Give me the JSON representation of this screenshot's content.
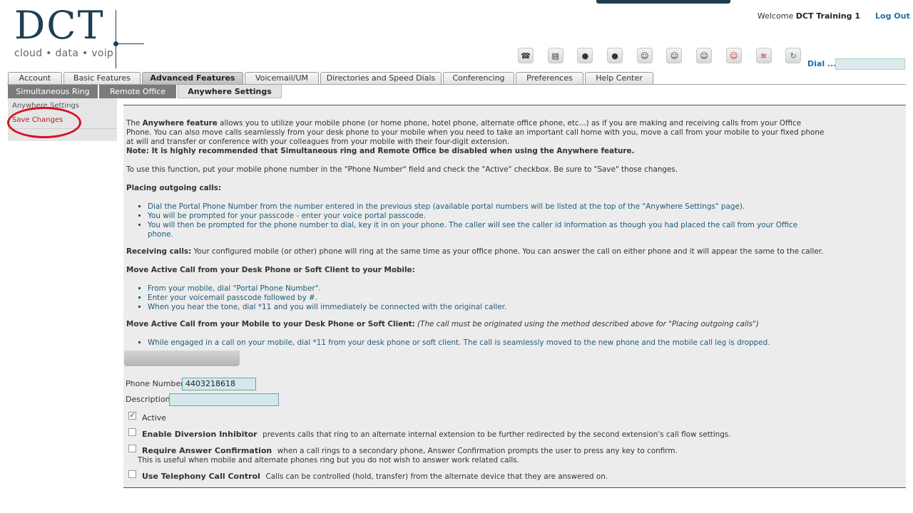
{
  "logo": {
    "letters": "DCT",
    "tagline": "cloud • data • voip"
  },
  "header": {
    "welcome_prefix": "Welcome",
    "user_name": "DCT Training 1",
    "logout": "Log Out",
    "dial_label": "Dial ...",
    "dial_value": ""
  },
  "icons": [
    "contacts-icon",
    "notes-icon",
    "voicemail-8-icon",
    "voicemail-700-icon",
    "user-icon",
    "user-group-icon",
    "user-admin-icon",
    "user-red-icon",
    "wifi-icon",
    "refresh-icon"
  ],
  "tabs": [
    {
      "label": "Account"
    },
    {
      "label": "Basic Features"
    },
    {
      "label": "Advanced Features"
    },
    {
      "label": "Voicemail/UM"
    },
    {
      "label": "Directories and Speed Dials"
    },
    {
      "label": "Conferencing"
    },
    {
      "label": "Preferences"
    },
    {
      "label": "Help Center"
    }
  ],
  "subtabs": [
    {
      "label": "Simultaneous Ring"
    },
    {
      "label": "Remote Office"
    },
    {
      "label": "Anywhere Settings"
    }
  ],
  "sidenav": {
    "item1": "Anywhere Settings",
    "item2": "Save Changes"
  },
  "content": {
    "intro_1": "The ",
    "intro_bold": "Anywhere feature",
    "intro_2": " allows you to utilize your mobile phone (or home phone, hotel phone, alternate office phone, etc...) as if you are making and receiving calls from your Office Phone. You can also move calls seamlessly from your desk phone to your mobile when you need to take an important call home with you, move a call from your mobile to your fixed phone at will and transfer or conference with your colleagues from your mobile with their four-digit extension.",
    "note": "Note: It is highly recommended that Simultaneous ring and Remote Office be disabled when using the Anywhere feature.",
    "use_text": "To use this function, put your mobile phone number in the \"Phone Number\" field and check the \"Active\" checkbox. Be sure to \"Save\" those changes.",
    "outgoing_head": "Placing outgoing calls:",
    "outgoing_items": [
      "Dial the Portal Phone Number from the number entered in the previous step (available portal numbers will be listed at the top of the \"Anywhere Settings\" page).",
      "You will be prompted for your passcode - enter your voice portal passcode.",
      "You will then be prompted for the phone number to dial, key it in on your phone. The caller will see the caller id information as though you had placed the call from your Office phone."
    ],
    "receiving_head": "Receiving calls:",
    "receiving_text": " Your configured mobile (or other) phone will ring at the same time as your office phone. You can answer the call on either phone and it will appear the same to the caller.",
    "desk_to_mobile_head": "Move Active Call from your Desk Phone or Soft Client to your Mobile:",
    "desk_to_mobile_items": [
      "From your mobile, dial \"Portal Phone Number\".",
      "Enter your voicemail passcode followed by #.",
      "When you hear the tone, dial *11 and you will immediately be connected with the original caller."
    ],
    "mobile_to_desk_head": "Move Active Call from your Mobile to your Desk Phone or Soft Client:",
    "mobile_to_desk_note": " (The call must be originated using the method described above for \"Placing outgoing calls\")",
    "mobile_to_desk_items": [
      "While engaged in a call on your mobile, dial *11 from your desk phone or soft client. The call is seamlessly moved to the new phone and the mobile call leg is dropped."
    ]
  },
  "form": {
    "phone_label": "Phone Number:",
    "phone_value": "4403218618",
    "desc_label": "Description:",
    "desc_value": "",
    "active_label": "Active",
    "active_checked": true,
    "diversion_title": "Enable Diversion Inhibitor",
    "diversion_desc": "prevents calls that ring to an alternate internal extension to be further redirected by the second extension's call flow settings.",
    "answer_title": "Require Answer Confirmation",
    "answer_desc": "when a call rings to a secondary phone, Answer Confirmation prompts the user to press any key to confirm.",
    "answer_desc2": "This is useful when mobile and alternate phones ring but you do not wish to answer work related calls.",
    "telephony_title": "Use Telephony Call Control",
    "telephony_desc": "Calls can be controlled (hold, transfer) from the alternate device that they are answered on."
  },
  "colors": {
    "brand": "#1f3e52",
    "link": "#1f6fa7",
    "highlight": "#d41524"
  }
}
